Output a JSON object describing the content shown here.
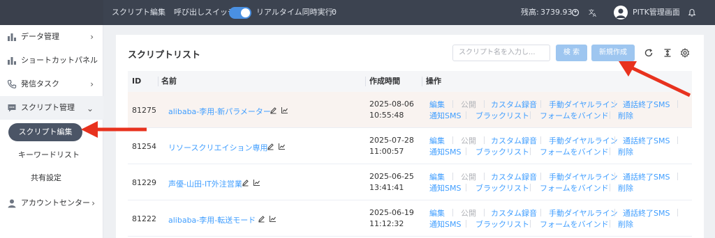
{
  "topbar": {
    "tab_title": "スクリプト編集",
    "switch_label": "呼び出しスイッチ",
    "switch_on": true,
    "realtime_label": "リアルタイム同時実行:",
    "realtime_value": "0",
    "balance_label": "残高:",
    "balance_value": "3739.93",
    "user_name": "PITK管理画面"
  },
  "sidebar": {
    "items": [
      {
        "label": "データ管理",
        "icon": "bar-chart-icon"
      },
      {
        "label": "ショートカットパネル",
        "icon": "bar-chart-icon"
      },
      {
        "label": "発信タスク",
        "icon": "phone-icon"
      },
      {
        "label": "スクリプト管理",
        "icon": "chat-icon"
      },
      {
        "label": "アカウントセンター",
        "icon": "user-icon"
      }
    ],
    "sub_items": [
      "スクリプト編集",
      "キーワードリスト",
      "共有設定"
    ]
  },
  "main": {
    "title": "スクリプトリスト",
    "search_placeholder": "スクリプト名を入力し...",
    "search_button": "検 索",
    "new_button": "新規作成",
    "columns": [
      "ID",
      "名前",
      "作成時間",
      "操作"
    ],
    "rows": [
      {
        "id": "81275",
        "name": "alibaba-李用-新パラメーター",
        "date": "2025-08-06",
        "time": "10:55:48"
      },
      {
        "id": "81254",
        "name": "リソースクリエイション専用",
        "date": "2025-07-28",
        "time": "11:00:57"
      },
      {
        "id": "81229",
        "name": "声優-山田-IT外注営業",
        "date": "2025-06-25",
        "time": "13:41:41"
      },
      {
        "id": "81222",
        "name": "alibaba-李用-転送モード",
        "date": "2025-06-19",
        "time": "11:12:32"
      }
    ],
    "ops_line1": [
      "編集",
      "公開",
      "カスタム録音",
      "手動ダイヤルライン",
      "通話終了SMS"
    ],
    "ops_line2": [
      "通知SMS",
      "ブラックリスト",
      "フォームをバインド",
      "削除"
    ]
  },
  "colors": {
    "topbar": "#3c4350",
    "accent": "#409eff",
    "button_disabled": "#9ec6f0",
    "arrow": "#e8321e",
    "active_pill": "#4b5566"
  }
}
